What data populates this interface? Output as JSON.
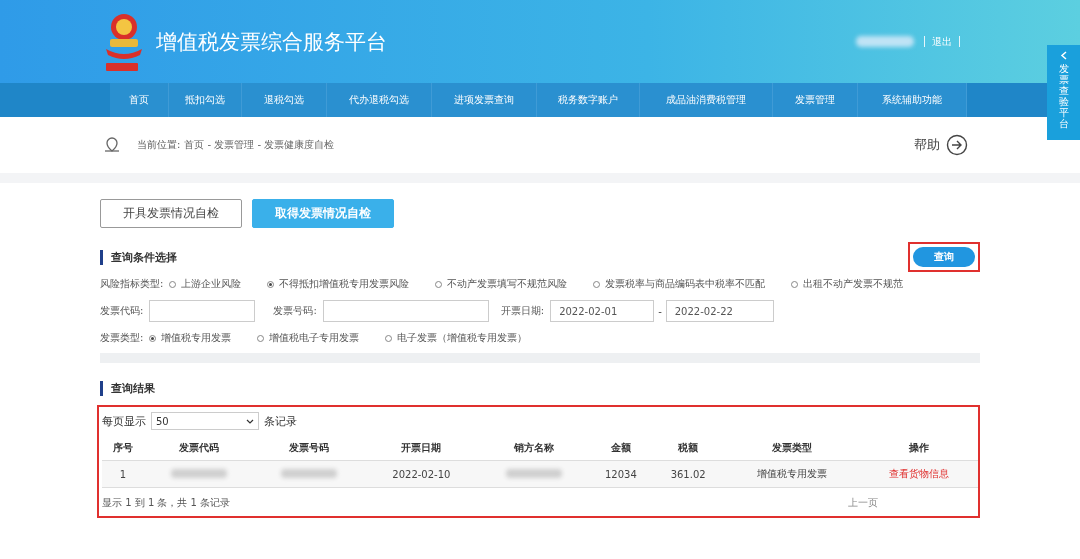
{
  "header": {
    "title": "增值税发票综合服务平台",
    "logout": "退出"
  },
  "side_tab": {
    "label": "发票查验平台"
  },
  "nav": [
    {
      "label": "首页"
    },
    {
      "label": "抵扣勾选"
    },
    {
      "label": "退税勾选"
    },
    {
      "label": "代办退税勾选"
    },
    {
      "label": "进项发票查询"
    },
    {
      "label": "税务数字账户"
    },
    {
      "label": "成品油消费税管理"
    },
    {
      "label": "发票管理"
    },
    {
      "label": "系统辅助功能"
    }
  ],
  "breadcrumb": {
    "prefix": "当前位置:",
    "path": "首页 - 发票管理 - 发票健康度自检",
    "help": "帮助"
  },
  "mode_tabs": [
    {
      "label": "开具发票情况自检",
      "selected": false
    },
    {
      "label": "取得发票情况自检",
      "selected": true
    }
  ],
  "query": {
    "title": "查询条件选择",
    "search_button": "查询",
    "highlighted": true,
    "risk_filter": {
      "label": "风险指标类型:",
      "options": [
        {
          "label": "上游企业风险",
          "selected": false
        },
        {
          "label": "不得抵扣增值税专用发票风险",
          "selected": true
        },
        {
          "label": "不动产发票填写不规范风险",
          "selected": false
        },
        {
          "label": "发票税率与商品编码表中税率不匹配",
          "selected": false
        },
        {
          "label": "出租不动产发票不规范",
          "selected": false
        }
      ]
    },
    "code_field": {
      "label": "发票代码:"
    },
    "number_field": {
      "label": "发票号码:"
    },
    "date_field": {
      "label": "开票日期:",
      "from": "2022-02-01",
      "separator": "-",
      "to": "2022-02-22"
    },
    "invoice_type": {
      "label": "发票类型:",
      "options": [
        {
          "label": "增值税专用发票",
          "selected": true
        },
        {
          "label": "增值税电子专用发票",
          "selected": false
        },
        {
          "label": "电子发票（增值税专用发票）",
          "selected": false
        }
      ]
    }
  },
  "results": {
    "title": "查询结果",
    "highlighted": true,
    "page_size_label": "每页显示",
    "page_size": "50",
    "page_size_suffix": "条记录",
    "columns": [
      "序号",
      "发票代码",
      "发票号码",
      "开票日期",
      "销方名称",
      "金额",
      "税额",
      "发票类型",
      "操作"
    ],
    "rows": [
      {
        "cells": [
          {
            "kind": "text",
            "text": "1"
          },
          {
            "kind": "blurred"
          },
          {
            "kind": "blurred"
          },
          {
            "kind": "text",
            "text": "2022-02-10"
          },
          {
            "kind": "blurred"
          },
          {
            "kind": "text",
            "text": "12034"
          },
          {
            "kind": "text",
            "text": "361.02"
          },
          {
            "kind": "text",
            "text": "增值税专用发票"
          },
          {
            "kind": "link",
            "text": "查看货物信息"
          }
        ]
      }
    ],
    "summary": "显示 1 到 1 条，共 1 条记录",
    "prev_page": "上一页"
  }
}
